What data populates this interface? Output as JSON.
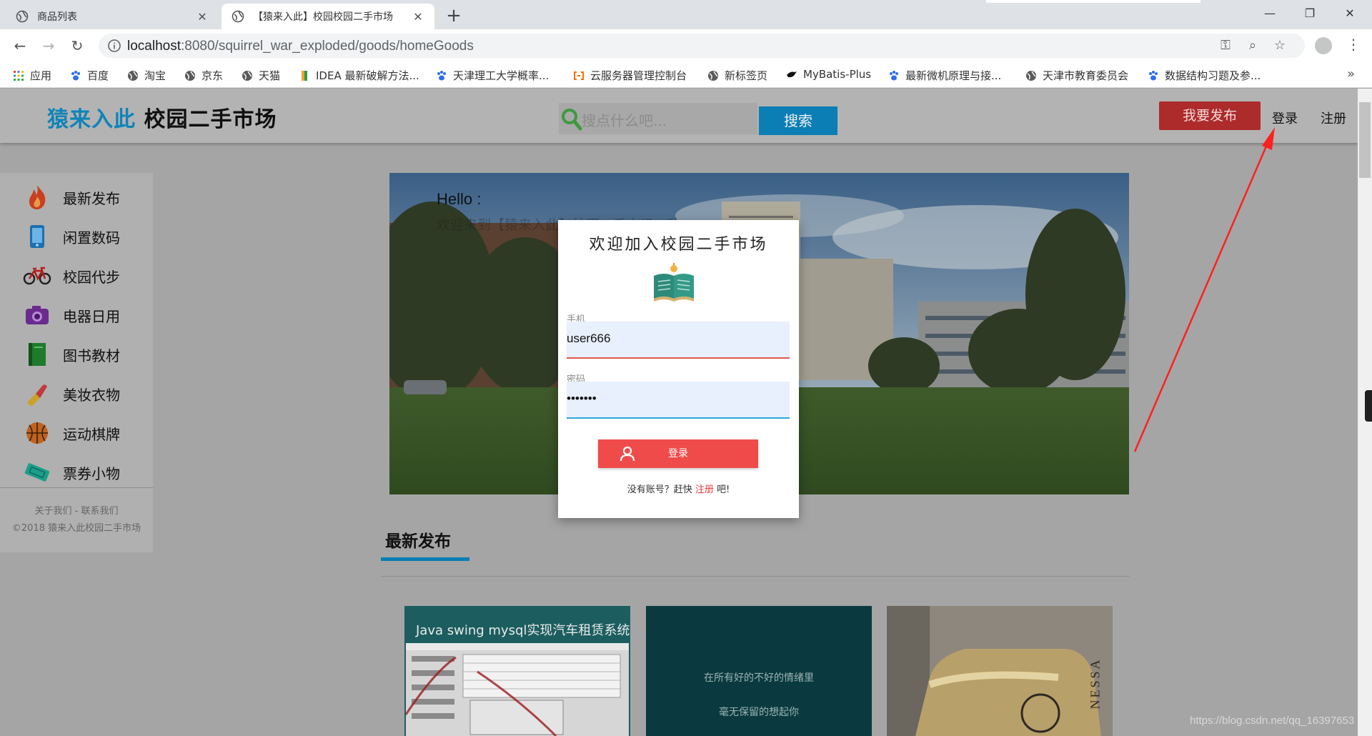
{
  "browser": {
    "tabs": [
      {
        "title": "商品列表",
        "close": "✕",
        "active": false
      },
      {
        "title": "【猿来入此】校园校园二手市场",
        "close": "✕",
        "active": true
      }
    ],
    "new_tab": "+",
    "window_controls": {
      "minimize": "—",
      "restore": "❐",
      "close": "✕"
    },
    "url_host": "localhost",
    "url_rest": ":8080/squirrel_war_exploded/goods/homeGoods",
    "bookmarks": [
      {
        "label": "应用",
        "icon": "apps-grid-icon"
      },
      {
        "label": "百度",
        "icon": "baidu-paw-icon"
      },
      {
        "label": "淘宝",
        "icon": "globe-icon"
      },
      {
        "label": "京东",
        "icon": "globe-icon"
      },
      {
        "label": "天猫",
        "icon": "globe-icon"
      },
      {
        "label": "IDEA 最新破解方法...",
        "icon": "idea-icon"
      },
      {
        "label": "天津理工大学概率...",
        "icon": "baidu-paw-icon"
      },
      {
        "label": "云服务器管理控制台",
        "icon": "aliyun-icon"
      },
      {
        "label": "新标签页",
        "icon": "globe-icon"
      },
      {
        "label": "MyBatis-Plus",
        "icon": "bird-icon"
      },
      {
        "label": "最新微机原理与接...",
        "icon": "baidu-paw-icon"
      },
      {
        "label": "天津市教育委员会",
        "icon": "globe-icon"
      },
      {
        "label": "数据结构习题及参...",
        "icon": "baidu-paw-icon"
      }
    ],
    "bookmarks_more": "»"
  },
  "header": {
    "brand_accent": "猿来入此",
    "brand_rest": " 校园二手市场",
    "search_placeholder": "搜点什么吧...",
    "search_button": "搜索",
    "publish_button": "我要发布",
    "login_link": "登录",
    "register_link": "注册"
  },
  "sidebar": {
    "categories": [
      {
        "label": "最新发布",
        "icon": "fire-icon"
      },
      {
        "label": "闲置数码",
        "icon": "phone-icon"
      },
      {
        "label": "校园代步",
        "icon": "bicycle-icon"
      },
      {
        "label": "电器日用",
        "icon": "camera-icon"
      },
      {
        "label": "图书教材",
        "icon": "book-icon"
      },
      {
        "label": "美妆衣物",
        "icon": "lipstick-icon"
      },
      {
        "label": "运动棋牌",
        "icon": "basketball-icon"
      },
      {
        "label": "票券小物",
        "icon": "ticket-icon"
      }
    ],
    "footer_links": "关于我们 - 联系我们",
    "copyright": "©2018 猿来入此校园二手市场"
  },
  "banner": {
    "hello": "Hello :",
    "subtitle": "欢迎来到【猿来入此】校园二手市场，购"
  },
  "section": {
    "title": "最新发布"
  },
  "cards": [
    {
      "title": "Java swing mysql实现汽车租赁系统"
    },
    {
      "line1": "在所有好的不好的情绪里",
      "line2": "毫无保留的想起你"
    },
    {
      "label": "NESSA"
    }
  ],
  "login_modal": {
    "title": "欢迎加入校园二手市场",
    "phone_label": "手机",
    "phone_value": "user666",
    "password_label": "密码",
    "password_value": "•••••••",
    "login_button": "登录",
    "signup_prefix": "没有账号？赶快 ",
    "signup_link": "注册",
    "signup_suffix": " 吧!"
  },
  "watermark": "https://blog.csdn.net/qq_16397653",
  "colors": {
    "brand_blue": "#0f84b8",
    "publish_red": "#ad2b2b",
    "login_red": "#f04b4b",
    "field_bg": "#e8effd",
    "annotation_arrow": "#ff2020"
  }
}
